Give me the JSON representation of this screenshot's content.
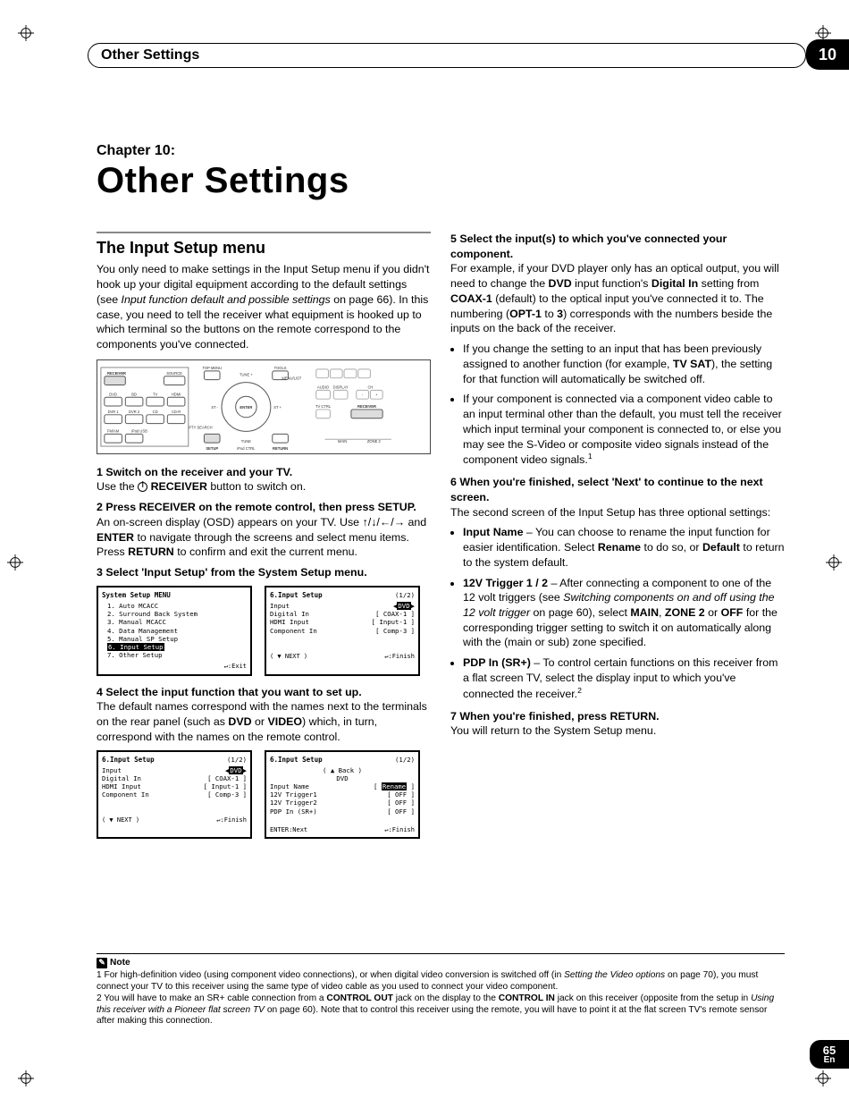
{
  "page": {
    "number": "65",
    "lang": "En",
    "chip": "10"
  },
  "header": {
    "title": "Other Settings"
  },
  "chapter": {
    "label": "Chapter 10:",
    "title": "Other Settings"
  },
  "left": {
    "section_title": "The Input Setup menu",
    "intro": "You only need to make settings in the Input Setup menu if you didn't hook up your digital equipment according to the default settings (see ",
    "intro_italic": "Input function default and possible settings",
    "intro_tail": " on page 66). In this case, you need to tell the receiver what equipment is hooked up to which terminal so the buttons on the remote correspond to the components you've connected.",
    "remote_labels": [
      "RECEIVER",
      "SOURCE",
      "DVD",
      "BD",
      "TV",
      "HDMI",
      "DVR 1",
      "DVR 2",
      "CD",
      "CD-R",
      "FM/AM",
      "iPod USB",
      "TOP MENU",
      "TUNE",
      "TOOLS",
      "MENU/LIST",
      "ENTER",
      "SETUP",
      "RETURN",
      "PTY SEARCH",
      "ST",
      "AUDIO",
      "DISPLAY",
      "CH",
      "TV CTRL",
      "RECEIVER",
      "MAIN",
      "ZONE 2",
      "iPod CTRL"
    ],
    "step1_head": "1    Switch on the receiver and your TV.",
    "step1_body_a": "Use the ",
    "step1_body_b": " RECEIVER",
    "step1_body_c": " button to switch on.",
    "step2_head": "2    Press RECEIVER on the remote control, then press SETUP.",
    "step2_body_a": "An on-screen display (OSD) appears on your TV. Use ",
    "step2_arrows": "↑/↓/←/→",
    "step2_body_b": " and ",
    "step2_enter": "ENTER",
    "step2_body_c": " to navigate through the screens and select menu items. Press ",
    "step2_return": "RETURN",
    "step2_body_d": " to confirm and exit the current menu.",
    "step3_head": "3    Select 'Input Setup' from the System Setup menu.",
    "osd_a": {
      "title": "System Setup MENU",
      "items": [
        "1. Auto MCACC",
        "2. Surround Back System",
        "3. Manual MCACC",
        "4. Data Management",
        "5. Manual SP Setup",
        "6. Input Setup",
        "7. Other Setup"
      ],
      "highlight_index": 5,
      "foot_right": ":Exit"
    },
    "osd_b": {
      "title": "6.Input Setup",
      "page": "(1/2)",
      "rows": [
        [
          "Input",
          ":",
          "DVD"
        ],
        [
          "Digital In",
          "[",
          "COAX-1",
          "]"
        ],
        [
          "HDMI Input",
          "[",
          "Input-1",
          "]"
        ],
        [
          "Component In",
          "[",
          "Comp-3",
          "]"
        ]
      ],
      "highlight_row": 0,
      "foot_left": "( ▼ NEXT )",
      "foot_right": ":Finish"
    },
    "step4_head": "4    Select the input function that you want to set up.",
    "step4_body": "The default names correspond with the names next to the terminals on the rear panel (such as ",
    "step4_dvd": "DVD",
    "step4_or": " or ",
    "step4_video": "VIDEO",
    "step4_tail": ") which, in turn, correspond with the names on the remote control.",
    "osd_c": {
      "title": "6.Input Setup",
      "page": "(1/2)",
      "rows": [
        [
          "Input",
          ":",
          "DVD"
        ],
        [
          "Digital In",
          "[",
          "COAX-1",
          "]"
        ],
        [
          "HDMI Input",
          "[",
          "Input-1",
          "]"
        ],
        [
          "Component In",
          "[",
          "Comp-3",
          "]"
        ]
      ],
      "highlight_row": 0,
      "foot_left": "( ▼ NEXT )",
      "foot_right": ":Finish"
    },
    "osd_d": {
      "title": "6.Input Setup",
      "page": "(1/2)",
      "back": "( ▲ Back )",
      "dvd": "DVD",
      "rows": [
        [
          "Input Name",
          "[",
          "Rename",
          "]"
        ],
        [
          "12V Trigger1",
          "[",
          "OFF",
          "]"
        ],
        [
          "12V Trigger2",
          "[",
          "OFF",
          "]"
        ],
        [
          "PDP In (SR+)",
          "[",
          "OFF",
          "]"
        ]
      ],
      "highlight_row": 0,
      "foot_left": "ENTER:Next",
      "foot_right": ":Finish"
    }
  },
  "right": {
    "step5_head": "5    Select the input(s) to which you've connected your component.",
    "step5_body_a": "For example, if your DVD player only has an optical output, you will need to change the ",
    "step5_dvd": "DVD",
    "step5_body_b": " input function's ",
    "step5_digin": "Digital In",
    "step5_body_c": " setting from ",
    "step5_coax": "COAX-1",
    "step5_body_d": " (default) to the optical input you've connected it to. The numbering (",
    "step5_opt1": "OPT-1",
    "step5_to": " to ",
    "step5_3": "3",
    "step5_body_e": ") corresponds with the numbers beside the inputs on the back of the receiver.",
    "step5_bullet1_a": "If you change the setting to an input that has been previously assigned to another function (for example, ",
    "step5_tvsat": "TV SAT",
    "step5_bullet1_b": "), the setting for that function will automatically be switched off.",
    "step5_bullet2": "If your component is connected via a component video cable to an input terminal other than the default, you must tell the receiver which input terminal your component is connected to, or else you may see the S-Video or composite video signals instead of the component video signals.",
    "step5_sup": "1",
    "step6_head": "6    When you're finished, select 'Next' to continue to the next screen.",
    "step6_body": "The second screen of the Input Setup has three optional settings:",
    "step6_b1_label": "Input Name",
    "step6_b1_text": " – You can choose to rename the input function for easier identification. Select ",
    "step6_b1_rename": "Rename",
    "step6_b1_text2": " to do so, or ",
    "step6_b1_default": "Default",
    "step6_b1_text3": " to return to the system default.",
    "step6_b2_label": "12V Trigger 1 / 2",
    "step6_b2_text": " – After connecting a component to one of the 12 volt triggers (see ",
    "step6_b2_italic": "Switching components on and off using the 12 volt trigger",
    "step6_b2_text2": " on page 60), select ",
    "step6_b2_main": "MAIN",
    "step6_b2_c1": ", ",
    "step6_b2_zone": "ZONE 2",
    "step6_b2_c2": " or ",
    "step6_b2_off": "OFF",
    "step6_b2_text3": " for the corresponding trigger setting to switch it on automatically along with the (main or sub) zone specified.",
    "step6_b3_label": "PDP In (SR+)",
    "step6_b3_text": " – To control certain functions on this receiver from a flat screen TV, select the display input to which you've connected the receiver.",
    "step6_b3_sup": "2",
    "step7_head": "7    When you're finished, press RETURN.",
    "step7_body": "You will return to the System Setup menu."
  },
  "notes": {
    "label": "Note",
    "n1_a": "1 For high-definition video (using component video connections), or when digital video conversion is switched off (in ",
    "n1_italic": "Setting the Video options",
    "n1_b": " on page 70), you must connect your TV to this receiver using the same type of video cable as you used to connect your video component.",
    "n2_a": "2 You will have to make an SR+ cable connection from a ",
    "n2_b1": "CONTROL OUT",
    "n2_c": " jack on the display to the ",
    "n2_b2": "CONTROL IN",
    "n2_d": " jack on this receiver (opposite from the setup in ",
    "n2_italic": "Using this receiver with a Pioneer flat screen TV",
    "n2_e": " on page 60). Note that to control this receiver using the remote, you will have to point it at the flat screen TV's remote sensor after making this connection."
  }
}
